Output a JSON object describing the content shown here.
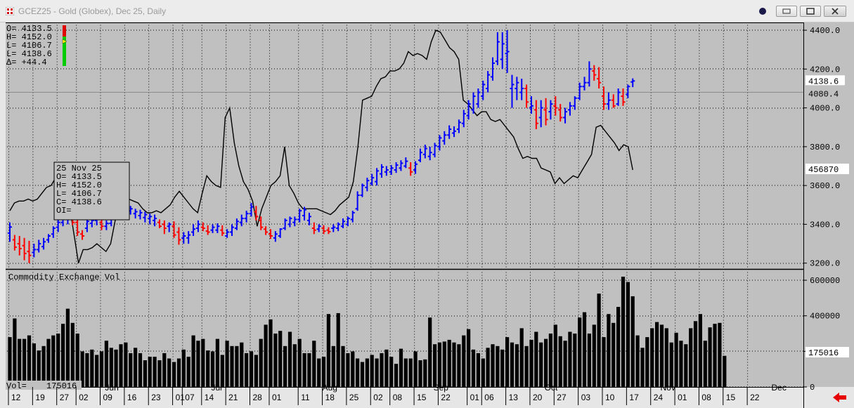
{
  "window": {
    "title": "GCEZ25 - Gold (Globex), Dec 25, Daily"
  },
  "colors": {
    "background": "#c0c0c0",
    "up_bar": "#0000ff",
    "down_bar": "#ff0000",
    "line": "#000000",
    "volume": "#000000",
    "arrow": "#e60000"
  },
  "quote_box": {
    "lines": [
      "O=  4133.5",
      "H=  4152.0",
      "L=  4106.7",
      "L=  4138.6",
      "Δ=   +44.4"
    ]
  },
  "tooltip": {
    "lines": [
      "25 Nov 25",
      "O=        4133.5",
      "H=        4152.0",
      "L=        4106.7",
      "C=        4138.6",
      "OI="
    ]
  },
  "volume_panel": {
    "title": "Commodity Exchange Vol",
    "readout_label": "Vol=",
    "readout_value": "175016"
  },
  "chart_data": {
    "type": "bar",
    "price": {
      "axis_ticks": [
        "4400.0",
        "4200.0",
        "4000.0",
        "3800.0",
        "3600.0",
        "3400.0",
        "3200.0"
      ],
      "ylim": [
        3170,
        4440
      ],
      "last_price_tag": "4138.6",
      "reference_tag": "4080.4",
      "reference_value": 4080.4,
      "overlay_tag": "456870",
      "bars": [
        [
          3355,
          3410,
          3310,
          3386
        ],
        [
          3320,
          3345,
          3265,
          3282
        ],
        [
          3300,
          3340,
          3240,
          3275
        ],
        [
          3290,
          3330,
          3215,
          3250
        ],
        [
          3260,
          3315,
          3200,
          3240
        ],
        [
          3255,
          3300,
          3230,
          3270
        ],
        [
          3270,
          3320,
          3255,
          3300
        ],
        [
          3285,
          3330,
          3270,
          3310
        ],
        [
          3320,
          3350,
          3305,
          3340
        ],
        [
          3350,
          3390,
          3330,
          3380
        ],
        [
          3385,
          3425,
          3360,
          3410
        ],
        [
          3410,
          3445,
          3390,
          3430
        ],
        [
          3430,
          3460,
          3400,
          3445
        ],
        [
          3440,
          3460,
          3395,
          3410
        ],
        [
          3410,
          3425,
          3340,
          3360
        ],
        [
          3350,
          3370,
          3320,
          3340
        ],
        [
          3380,
          3430,
          3360,
          3415
        ],
        [
          3405,
          3440,
          3385,
          3420
        ],
        [
          3420,
          3450,
          3395,
          3435
        ],
        [
          3410,
          3435,
          3370,
          3390
        ],
        [
          3390,
          3420,
          3370,
          3405
        ],
        [
          3405,
          3445,
          3390,
          3435
        ],
        [
          3440,
          3480,
          3425,
          3470
        ],
        [
          3470,
          3495,
          3440,
          3480
        ],
        [
          3460,
          3500,
          3440,
          3490
        ],
        [
          3470,
          3495,
          3450,
          3480
        ],
        [
          3455,
          3480,
          3430,
          3465
        ],
        [
          3445,
          3475,
          3425,
          3460
        ],
        [
          3435,
          3465,
          3410,
          3450
        ],
        [
          3430,
          3455,
          3400,
          3440
        ],
        [
          3420,
          3450,
          3390,
          3430
        ],
        [
          3410,
          3425,
          3380,
          3390
        ],
        [
          3400,
          3420,
          3350,
          3380
        ],
        [
          3390,
          3410,
          3360,
          3400
        ],
        [
          3390,
          3415,
          3330,
          3345
        ],
        [
          3360,
          3385,
          3295,
          3320
        ],
        [
          3330,
          3360,
          3300,
          3340
        ],
        [
          3330,
          3365,
          3300,
          3345
        ],
        [
          3360,
          3400,
          3340,
          3375
        ],
        [
          3380,
          3420,
          3360,
          3400
        ],
        [
          3385,
          3410,
          3365,
          3380
        ],
        [
          3365,
          3395,
          3345,
          3360
        ],
        [
          3370,
          3400,
          3355,
          3385
        ],
        [
          3370,
          3405,
          3355,
          3390
        ],
        [
          3370,
          3395,
          3340,
          3355
        ],
        [
          3340,
          3375,
          3330,
          3360
        ],
        [
          3360,
          3400,
          3340,
          3385
        ],
        [
          3380,
          3430,
          3370,
          3415
        ],
        [
          3410,
          3450,
          3390,
          3430
        ],
        [
          3430,
          3470,
          3410,
          3455
        ],
        [
          3455,
          3510,
          3440,
          3490
        ],
        [
          3465,
          3495,
          3420,
          3440
        ],
        [
          3420,
          3440,
          3370,
          3385
        ],
        [
          3375,
          3390,
          3345,
          3360
        ],
        [
          3350,
          3375,
          3325,
          3340
        ],
        [
          3330,
          3365,
          3310,
          3350
        ],
        [
          3340,
          3380,
          3330,
          3375
        ],
        [
          3380,
          3430,
          3370,
          3420
        ],
        [
          3400,
          3440,
          3385,
          3430
        ],
        [
          3410,
          3440,
          3390,
          3425
        ],
        [
          3425,
          3480,
          3410,
          3470
        ],
        [
          3445,
          3490,
          3420,
          3475
        ],
        [
          3420,
          3460,
          3395,
          3440
        ],
        [
          3380,
          3410,
          3350,
          3370
        ],
        [
          3375,
          3400,
          3360,
          3390
        ],
        [
          3380,
          3395,
          3350,
          3365
        ],
        [
          3370,
          3385,
          3350,
          3362
        ],
        [
          3380,
          3400,
          3360,
          3385
        ],
        [
          3380,
          3410,
          3365,
          3400
        ],
        [
          3390,
          3430,
          3380,
          3415
        ],
        [
          3400,
          3440,
          3390,
          3430
        ],
        [
          3425,
          3470,
          3410,
          3460
        ],
        [
          3480,
          3570,
          3470,
          3550
        ],
        [
          3550,
          3610,
          3540,
          3600
        ],
        [
          3590,
          3640,
          3570,
          3625
        ],
        [
          3610,
          3660,
          3600,
          3640
        ],
        [
          3620,
          3690,
          3600,
          3675
        ],
        [
          3660,
          3710,
          3640,
          3695
        ],
        [
          3670,
          3700,
          3650,
          3680
        ],
        [
          3670,
          3705,
          3655,
          3690
        ],
        [
          3680,
          3720,
          3665,
          3705
        ],
        [
          3690,
          3730,
          3675,
          3715
        ],
        [
          3700,
          3745,
          3690,
          3725
        ],
        [
          3690,
          3720,
          3650,
          3670
        ],
        [
          3680,
          3725,
          3660,
          3710
        ],
        [
          3730,
          3790,
          3720,
          3770
        ],
        [
          3760,
          3810,
          3740,
          3790
        ],
        [
          3750,
          3800,
          3730,
          3770
        ],
        [
          3760,
          3820,
          3745,
          3805
        ],
        [
          3800,
          3860,
          3780,
          3845
        ],
        [
          3830,
          3880,
          3810,
          3860
        ],
        [
          3860,
          3910,
          3840,
          3890
        ],
        [
          3870,
          3905,
          3850,
          3880
        ],
        [
          3890,
          3940,
          3870,
          3925
        ],
        [
          3920,
          3990,
          3900,
          3970
        ],
        [
          3960,
          4040,
          3940,
          4020
        ],
        [
          3990,
          4080,
          3970,
          4060
        ],
        [
          4020,
          4100,
          4000,
          4080
        ],
        [
          4060,
          4140,
          4040,
          4120
        ],
        [
          4100,
          4190,
          4080,
          4170
        ],
        [
          4160,
          4260,
          4140,
          4230
        ],
        [
          4240,
          4390,
          4220,
          4340
        ],
        [
          4250,
          4390,
          4200,
          4330
        ],
        [
          4280,
          4400,
          4180,
          4290
        ],
        [
          4100,
          4170,
          4000,
          4120
        ],
        [
          4100,
          4160,
          4040,
          4130
        ],
        [
          4080,
          4150,
          4040,
          4100
        ],
        [
          4100,
          4120,
          4000,
          4030
        ],
        [
          4000,
          4060,
          3970,
          4010
        ],
        [
          3990,
          4040,
          3890,
          3920
        ],
        [
          3950,
          4040,
          3900,
          4000
        ],
        [
          3990,
          4050,
          3910,
          3940
        ],
        [
          3980,
          4040,
          3940,
          4020
        ],
        [
          4010,
          4060,
          3960,
          4000
        ],
        [
          3990,
          4020,
          3930,
          3950
        ],
        [
          3950,
          4000,
          3920,
          3980
        ],
        [
          3990,
          4030,
          3960,
          4010
        ],
        [
          4010,
          4060,
          3990,
          4050
        ],
        [
          4050,
          4130,
          4040,
          4110
        ],
        [
          4110,
          4160,
          4090,
          4130
        ],
        [
          4130,
          4240,
          4110,
          4200
        ],
        [
          4190,
          4220,
          4140,
          4170
        ],
        [
          4150,
          4210,
          4100,
          4130
        ],
        [
          4060,
          4110,
          3990,
          4020
        ],
        [
          4020,
          4080,
          3990,
          4040
        ],
        [
          4040,
          4070,
          4000,
          4010
        ],
        [
          4020,
          4100,
          4010,
          4080
        ],
        [
          4060,
          4100,
          4010,
          4030
        ],
        [
          4070,
          4120,
          4050,
          4110
        ],
        [
          4133.5,
          4152.0,
          4106.7,
          4138.6
        ]
      ]
    },
    "line_series": [
      3470,
      3510,
      3520,
      3520,
      3530,
      3520,
      3530,
      3560,
      3590,
      3600,
      3640,
      3620,
      3600,
      3500,
      3350,
      3200,
      3270,
      3270,
      3280,
      3300,
      3280,
      3260,
      3300,
      3420,
      3500,
      3520,
      3530,
      3520,
      3510,
      3480,
      3460,
      3460,
      3470,
      3460,
      3480,
      3500,
      3540,
      3570,
      3540,
      3510,
      3480,
      3460,
      3560,
      3650,
      3620,
      3600,
      3590,
      3950,
      4000,
      3820,
      3700,
      3620,
      3580,
      3520,
      3390,
      3480,
      3540,
      3600,
      3620,
      3650,
      3800,
      3600,
      3560,
      3510,
      3480,
      3480,
      3480,
      3480,
      3470,
      3460,
      3450,
      3470,
      3500,
      3520,
      3540,
      3620,
      3800,
      4040,
      4050,
      4060,
      4110,
      4150,
      4160,
      4190,
      4190,
      4200,
      4230,
      4290,
      4270,
      4280,
      4270,
      4250,
      4340,
      4400,
      4390,
      4350,
      4310,
      4290,
      4250,
      4040,
      4020,
      3990,
      3960,
      3980,
      3980,
      3940,
      3930,
      3940,
      3910,
      3880,
      3850,
      3790,
      3740,
      3750,
      3740,
      3740,
      3690,
      3680,
      3670,
      3610,
      3640,
      3610,
      3630,
      3650,
      3640,
      3680,
      3720,
      3760,
      3900,
      3910,
      3880,
      3850,
      3820,
      3780,
      3810,
      3800,
      3680
    ],
    "volume": {
      "axis_ticks": [
        "600000",
        "400000",
        "200000",
        "0"
      ],
      "ylim": [
        0,
        620000
      ],
      "values": [
        280000,
        385000,
        270000,
        270000,
        290000,
        245000,
        205000,
        230000,
        270000,
        290000,
        300000,
        355000,
        440000,
        360000,
        300000,
        200000,
        190000,
        210000,
        180000,
        200000,
        260000,
        220000,
        210000,
        240000,
        250000,
        190000,
        220000,
        190000,
        150000,
        170000,
        170000,
        150000,
        190000,
        160000,
        140000,
        160000,
        210000,
        170000,
        290000,
        260000,
        270000,
        205000,
        200000,
        270000,
        180000,
        260000,
        230000,
        230000,
        250000,
        190000,
        200000,
        180000,
        270000,
        350000,
        380000,
        300000,
        315000,
        230000,
        310000,
        240000,
        270000,
        190000,
        190000,
        260000,
        160000,
        170000,
        410000,
        230000,
        415000,
        230000,
        190000,
        200000,
        160000,
        140000,
        160000,
        180000,
        160000,
        190000,
        210000,
        170000,
        130000,
        215000,
        160000,
        160000,
        200000,
        150000,
        155000,
        390000,
        240000,
        250000,
        255000,
        265000,
        250000,
        240000,
        290000,
        325000,
        210000,
        190000,
        160000,
        220000,
        240000,
        230000,
        210000,
        280000,
        250000,
        240000,
        330000,
        230000,
        265000,
        310000,
        250000,
        270000,
        300000,
        350000,
        285000,
        260000,
        310000,
        300000,
        390000,
        420000,
        300000,
        350000,
        525000,
        280000,
        410000,
        360000,
        450000,
        620000,
        590000,
        510000,
        290000,
        220000,
        280000,
        330000,
        365000,
        350000,
        330000,
        250000,
        305000,
        260000,
        240000,
        330000,
        370000,
        410000,
        260000,
        335000,
        355000,
        360000,
        175016
      ]
    },
    "x_axis": {
      "month_labels": [
        {
          "label": "Jun",
          "index": 20
        },
        {
          "label": "Jul",
          "index": 42
        },
        {
          "label": "Aug",
          "index": 65
        },
        {
          "label": "Sep",
          "index": 88
        },
        {
          "label": "Oct",
          "index": 111
        },
        {
          "label": "Nov",
          "index": 135
        },
        {
          "label": "Dec",
          "index": 158
        }
      ],
      "day_labels": [
        {
          "label": "12",
          "index": 0
        },
        {
          "label": "19",
          "index": 5
        },
        {
          "label": "27",
          "index": 10
        },
        {
          "label": "02",
          "index": 14
        },
        {
          "label": "09",
          "index": 19
        },
        {
          "label": "16",
          "index": 24
        },
        {
          "label": "23",
          "index": 29
        },
        {
          "label": "01",
          "index": 34
        },
        {
          "label": "07",
          "index": 36
        },
        {
          "label": "14",
          "index": 40
        },
        {
          "label": "21",
          "index": 45
        },
        {
          "label": "28",
          "index": 50
        },
        {
          "label": "01",
          "index": 54
        },
        {
          "label": "11",
          "index": 60
        },
        {
          "label": "18",
          "index": 65
        },
        {
          "label": "25",
          "index": 70
        },
        {
          "label": "02",
          "index": 75
        },
        {
          "label": "08",
          "index": 79
        },
        {
          "label": "15",
          "index": 84
        },
        {
          "label": "22",
          "index": 89
        },
        {
          "label": "01",
          "index": 95
        },
        {
          "label": "06",
          "index": 98
        },
        {
          "label": "13",
          "index": 103
        },
        {
          "label": "20",
          "index": 108
        },
        {
          "label": "27",
          "index": 113
        },
        {
          "label": "03",
          "index": 118
        },
        {
          "label": "10",
          "index": 123
        },
        {
          "label": "17",
          "index": 128
        },
        {
          "label": "24",
          "index": 133
        },
        {
          "label": "01",
          "index": 138
        },
        {
          "label": "08",
          "index": 143
        },
        {
          "label": "15",
          "index": 148
        },
        {
          "label": "22",
          "index": 153
        }
      ]
    }
  }
}
